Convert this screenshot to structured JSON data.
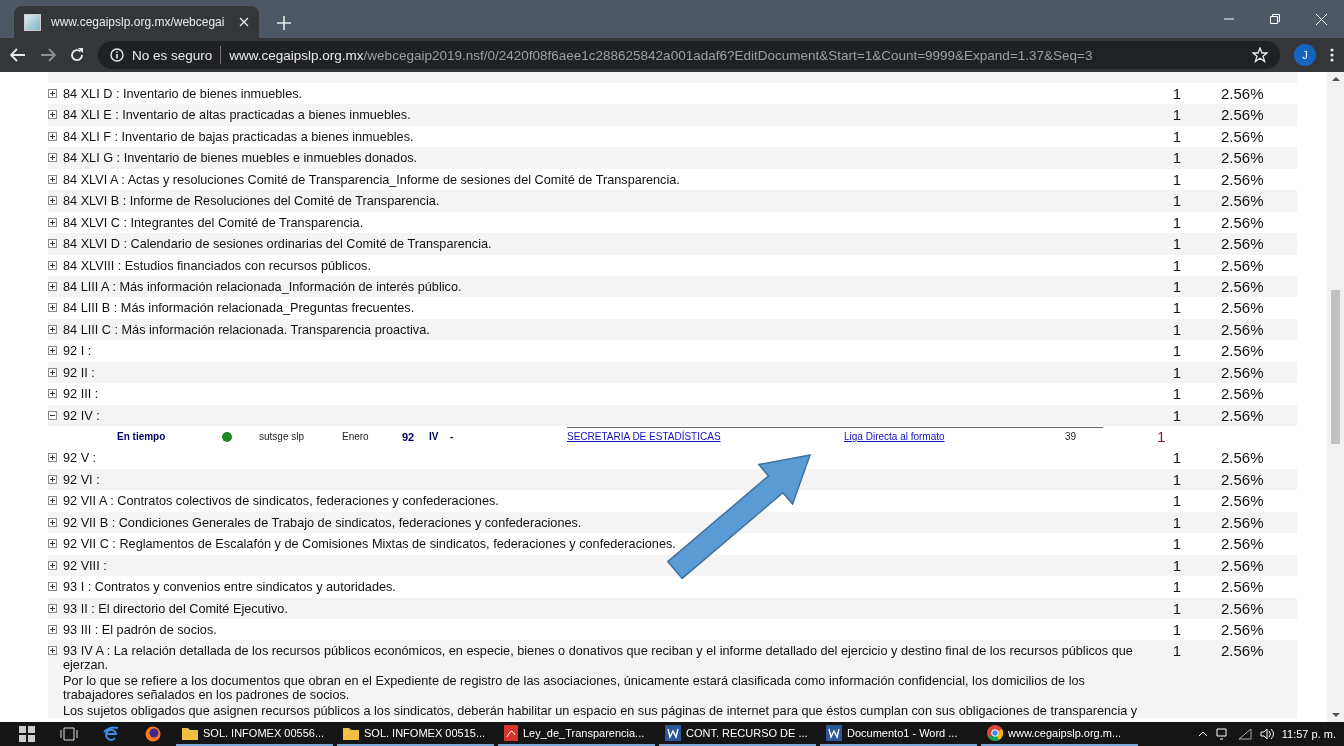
{
  "browser": {
    "tab_title": "www.cegaipslp.org.mx/webcegai",
    "security": "No es seguro",
    "url_host": "www.cegaipslp.org.mx",
    "url_path": "/webcegaip2019.nsf/0/2420f08f6aee1c288625842a001adaf6?EditDocument&Start=1&Count=9999&Expand=1.37&Seq=3",
    "avatar": "J"
  },
  "rows": [
    {
      "text": "84 XLI D : Inventario de bienes inmuebles.",
      "count": "1",
      "percent": "2.56%",
      "expanded": false
    },
    {
      "text": "84 XLI E : Inventario de altas practicadas a bienes inmuebles.",
      "count": "1",
      "percent": "2.56%",
      "expanded": false
    },
    {
      "text": "84 XLI F : Inventario de bajas practicadas a bienes inmuebles.",
      "count": "1",
      "percent": "2.56%",
      "expanded": false
    },
    {
      "text": "84 XLI G : Inventario de bienes muebles e inmuebles donados.",
      "count": "1",
      "percent": "2.56%",
      "expanded": false
    },
    {
      "text": "84 XLVI A : Actas y resoluciones Comité de Transparencia_Informe de sesiones del Comité de Transparencia.",
      "count": "1",
      "percent": "2.56%",
      "expanded": false
    },
    {
      "text": "84 XLVI B : Informe de Resoluciones del Comité de Transparencia.",
      "count": "1",
      "percent": "2.56%",
      "expanded": false
    },
    {
      "text": "84 XLVI C : Integrantes del Comité de Transparencia.",
      "count": "1",
      "percent": "2.56%",
      "expanded": false
    },
    {
      "text": "84 XLVI D : Calendario de sesiones ordinarias del Comité de Transparencia.",
      "count": "1",
      "percent": "2.56%",
      "expanded": false
    },
    {
      "text": "84 XLVIII : Estudios financiados con recursos públicos.",
      "count": "1",
      "percent": "2.56%",
      "expanded": false
    },
    {
      "text": "84 LIII A : Más información relacionada_Información de interés público.",
      "count": "1",
      "percent": "2.56%",
      "expanded": false
    },
    {
      "text": "84 LIII B : Más información relacionada_Preguntas frecuentes.",
      "count": "1",
      "percent": "2.56%",
      "expanded": false
    },
    {
      "text": "84 LIII C : Más información relacionada. Transparencia proactiva.",
      "count": "1",
      "percent": "2.56%",
      "expanded": false
    },
    {
      "text": "92 I :",
      "count": "1",
      "percent": "2.56%",
      "expanded": false
    },
    {
      "text": "92 II :",
      "count": "1",
      "percent": "2.56%",
      "expanded": false
    },
    {
      "text": "92 III :",
      "count": "1",
      "percent": "2.56%",
      "expanded": false
    },
    {
      "text": "92 IV :",
      "count": "1",
      "percent": "2.56%",
      "expanded": true,
      "children": [
        {
          "status": "En tiempo",
          "color": "#1f8a1f",
          "owner": "sutsge slp",
          "month": "Enero",
          "article": "92",
          "fraction": "IV",
          "dash": "-",
          "area_link": "SECRETARIA DE ESTADÍSTICAS",
          "format_link": "Liga Directa al formato",
          "number": "39",
          "count": "1"
        }
      ]
    },
    {
      "text": "92 V :",
      "count": "1",
      "percent": "2.56%",
      "expanded": false
    },
    {
      "text": "92 VI :",
      "count": "1",
      "percent": "2.56%",
      "expanded": false
    },
    {
      "text": "92 VII A : Contratos colectivos de sindicatos, federaciones y confederaciones.",
      "count": "1",
      "percent": "2.56%",
      "expanded": false
    },
    {
      "text": "92 VII B : Condiciones Generales de Trabajo de sindicatos, federaciones y confederaciones.",
      "count": "1",
      "percent": "2.56%",
      "expanded": false
    },
    {
      "text": "92 VII C : Reglamentos de Escalafón y de Comisiones Mixtas de sindicatos, federaciones y confederaciones.",
      "count": "1",
      "percent": "2.56%",
      "expanded": false
    },
    {
      "text": "92 VIII :",
      "count": "1",
      "percent": "2.56%",
      "expanded": false
    },
    {
      "text": "93 I : Contratos y convenios entre sindicatos y autoridades.",
      "count": "1",
      "percent": "2.56%",
      "expanded": false
    },
    {
      "text": "93 II : El directorio del Comité Ejecutivo.",
      "count": "1",
      "percent": "2.56%",
      "expanded": false
    },
    {
      "text": "93 III : El padrón de socios.",
      "count": "1",
      "percent": "2.56%",
      "expanded": false
    },
    {
      "text": "93 IV A : La relación detallada de los recursos públicos económicos, en especie, bienes o donativos que reciban y el informe detallado del ejercicio y destino final de los recursos públicos que ejerzan.",
      "count": "1",
      "percent": "2.56%",
      "expanded": false,
      "notes": [
        "Por lo que se refiere a los documentos que obran en el Expediente de registro de las asociaciones, únicamente estará clasificada como información confidencial, los domicilios de los trabajadores señalados en los padrones de socios.",
        "Los sujetos obligados que asignen recursos públicos a los sindicatos, deberán habilitar un espacio en sus páginas de internet para que éstos cumplan con sus obligaciones de transparencia y"
      ]
    }
  ],
  "taskbar": {
    "apps": [
      {
        "kind": "folder",
        "label": "SOL. INFOMEX 00556..."
      },
      {
        "kind": "folder",
        "label": "SOL. INFOMEX 00515..."
      },
      {
        "kind": "pdf",
        "label": "Ley_de_Transparencia..."
      },
      {
        "kind": "word",
        "label": "CONT. RECURSO DE ..."
      },
      {
        "kind": "word",
        "label": "Documento1 - Word ..."
      },
      {
        "kind": "chrome",
        "label": "www.cegaipslp.org.m..."
      }
    ],
    "time": "11:57 p. m."
  }
}
